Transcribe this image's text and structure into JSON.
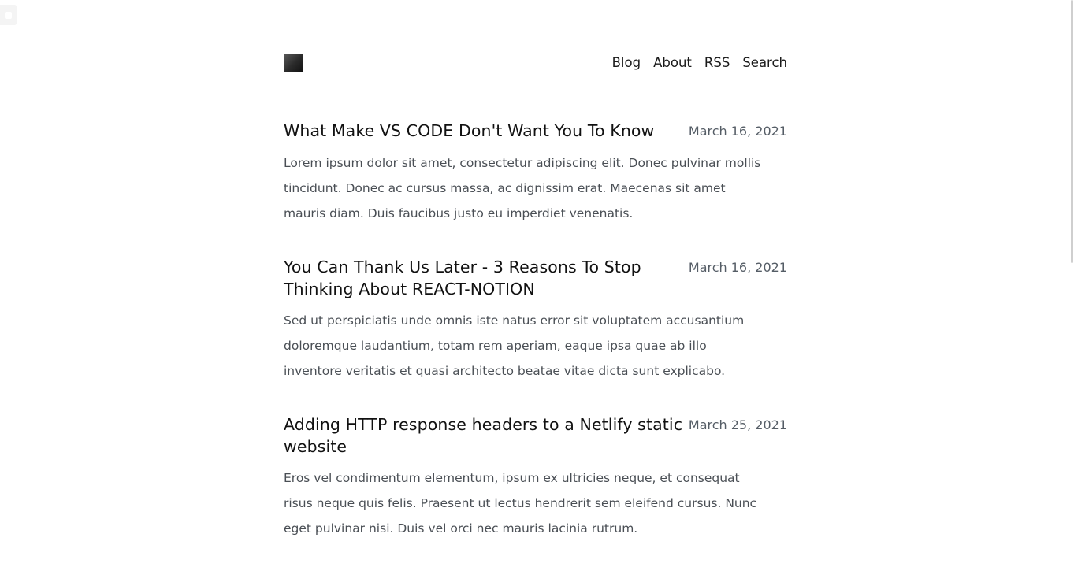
{
  "nav": {
    "blog": "Blog",
    "about": "About",
    "rss": "RSS",
    "search": "Search"
  },
  "posts": [
    {
      "title": "What Make VS CODE Don't Want You To Know",
      "date": "March 16, 2021",
      "excerpt": "Lorem ipsum dolor sit amet, consectetur adipiscing elit. Donec pulvinar mollis tincidunt. Donec ac cursus massa, ac dignissim erat. Maecenas sit amet mauris diam. Duis faucibus justo eu imperdiet venenatis."
    },
    {
      "title": "You Can Thank Us Later - 3 Reasons To Stop Thinking About REACT-NOTION",
      "date": "March 16, 2021",
      "excerpt": "Sed ut perspiciatis unde omnis iste natus error sit voluptatem accusantium doloremque laudantium, totam rem aperiam, eaque ipsa quae ab illo inventore veritatis et quasi architecto beatae vitae dicta sunt explicabo."
    },
    {
      "title": "Adding HTTP response headers to a Netlify static website",
      "date": "March 25, 2021",
      "excerpt": "Eros vel condimentum elementum, ipsum ex ultricies neque, et consequat risus neque quis felis. Praesent ut lectus hendrerit sem eleifend cursus. Nunc eget pulvinar nisi. Duis vel orci nec mauris lacinia rutrum."
    }
  ]
}
